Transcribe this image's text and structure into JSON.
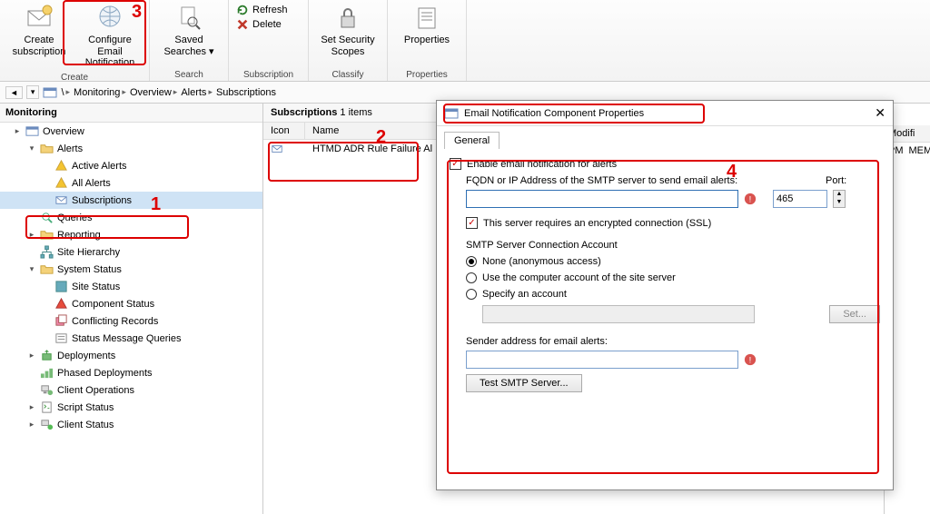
{
  "ribbon": {
    "groups": [
      {
        "label": "Create",
        "buttons": [
          {
            "label": "Create\nsubscription"
          },
          {
            "label": "Configure Email\nNotification"
          }
        ]
      },
      {
        "label": "Search",
        "buttons": [
          {
            "label": "Saved\nSearches ▾"
          }
        ],
        "side": [
          {
            "label": "Refresh",
            "color": "#2a7a2a"
          },
          {
            "label": "Delete",
            "color": "#c0392b"
          }
        ],
        "side_group_label": "Subscription"
      },
      {
        "label": "Classify",
        "buttons": [
          {
            "label": "Set Security\nScopes"
          }
        ]
      },
      {
        "label": "Properties",
        "buttons": [
          {
            "label": "Properties"
          }
        ]
      }
    ]
  },
  "breadcrumb": [
    "\\",
    "Monitoring",
    "Overview",
    "Alerts",
    "Subscriptions"
  ],
  "tree": {
    "title": "Monitoring",
    "nodes": [
      {
        "label": "Overview",
        "level": 1,
        "icon": "overview",
        "tw": "▸"
      },
      {
        "label": "Alerts",
        "level": 2,
        "icon": "folder",
        "tw": "▾"
      },
      {
        "label": "Active Alerts",
        "level": 3,
        "icon": "alert-yellow"
      },
      {
        "label": "All Alerts",
        "level": 3,
        "icon": "alert-yellow"
      },
      {
        "label": "Subscriptions",
        "level": 3,
        "icon": "subscription",
        "sel": true
      },
      {
        "label": "Queries",
        "level": 2,
        "icon": "queries"
      },
      {
        "label": "Reporting",
        "level": 2,
        "icon": "folder",
        "tw": "▸"
      },
      {
        "label": "Site Hierarchy",
        "level": 2,
        "icon": "hierarchy"
      },
      {
        "label": "System Status",
        "level": 2,
        "icon": "folder",
        "tw": "▾"
      },
      {
        "label": "Site Status",
        "level": 3,
        "icon": "sitestatus"
      },
      {
        "label": "Component Status",
        "level": 3,
        "icon": "component"
      },
      {
        "label": "Conflicting Records",
        "level": 3,
        "icon": "conflict"
      },
      {
        "label": "Status Message Queries",
        "level": 3,
        "icon": "statusmsg"
      },
      {
        "label": "Deployments",
        "level": 2,
        "icon": "deploy",
        "tw": "▸"
      },
      {
        "label": "Phased Deployments",
        "level": 2,
        "icon": "phased"
      },
      {
        "label": "Client Operations",
        "level": 2,
        "icon": "clientop"
      },
      {
        "label": "Script Status",
        "level": 2,
        "icon": "script",
        "tw": "▸"
      },
      {
        "label": "Client Status",
        "level": 2,
        "icon": "clientstatus",
        "tw": "▸"
      }
    ]
  },
  "list": {
    "title_prefix": "Subscriptions",
    "count_text": "1 items",
    "cols": {
      "icon": "Icon",
      "name": "Name"
    },
    "rows": [
      {
        "name": "HTMD ADR Rule Failure Al"
      }
    ]
  },
  "rightinfo": {
    "col1": "Modifi",
    "row1_a": "PM",
    "row1_b": "MEMC"
  },
  "dialog": {
    "title": "Email Notification Component Properties",
    "tab": "General",
    "enable_label": "Enable email notification for alerts",
    "fqdn_label": "FQDN or IP Address of the SMTP server to send email alerts:",
    "port_label": "Port:",
    "port_value": "465",
    "ssl_label": "This server requires an encrypted connection (SSL)",
    "conn_header": "SMTP Server Connection Account",
    "radio_none": "None (anonymous access)",
    "radio_computer": "Use the computer account of the site server",
    "radio_specify": "Specify an account",
    "set_btn": "Set...",
    "sender_label": "Sender address for email alerts:",
    "test_btn": "Test SMTP Server..."
  },
  "annotations": {
    "n1": "1",
    "n2": "2",
    "n3": "3",
    "n4": "4"
  }
}
